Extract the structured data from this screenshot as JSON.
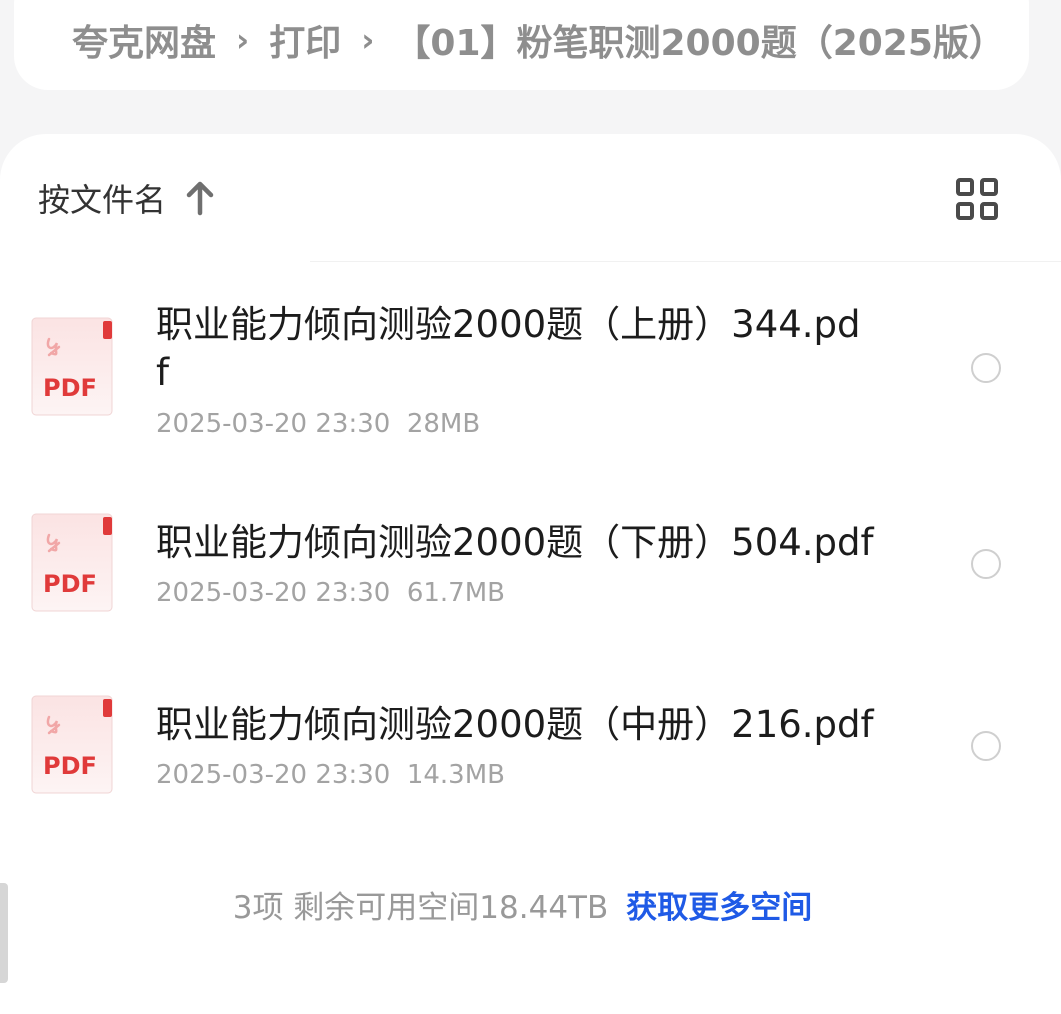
{
  "breadcrumb": {
    "items": [
      "夸克网盘",
      "打印",
      "【01】粉笔职测2000题（2025版）"
    ],
    "separator": "›"
  },
  "toolbar": {
    "sort_label": "按文件名",
    "sort_icon": "arrow-up-icon",
    "view_icon": "grid-view-icon"
  },
  "files": [
    {
      "icon": "pdf-file-icon",
      "icon_label": "PDF",
      "name": "职业能力倾向测验2000题（上册）344.pdf",
      "date": "2025-03-20 23:30",
      "size": "28MB",
      "selected": false
    },
    {
      "icon": "pdf-file-icon",
      "icon_label": "PDF",
      "name": "职业能力倾向测验2000题（下册）504.pdf",
      "date": "2025-03-20 23:30",
      "size": "61.7MB",
      "selected": false
    },
    {
      "icon": "pdf-file-icon",
      "icon_label": "PDF",
      "name": "职业能力倾向测验2000题（中册）216.pdf",
      "date": "2025-03-20 23:30",
      "size": "14.3MB",
      "selected": false
    }
  ],
  "footer": {
    "summary": "3项 剩余可用空间18.44TB",
    "more_space_link": "获取更多空间"
  },
  "colors": {
    "accent_link": "#1f5ae6",
    "pdf_red": "#e03a3a",
    "background": "#f5f5f6"
  }
}
